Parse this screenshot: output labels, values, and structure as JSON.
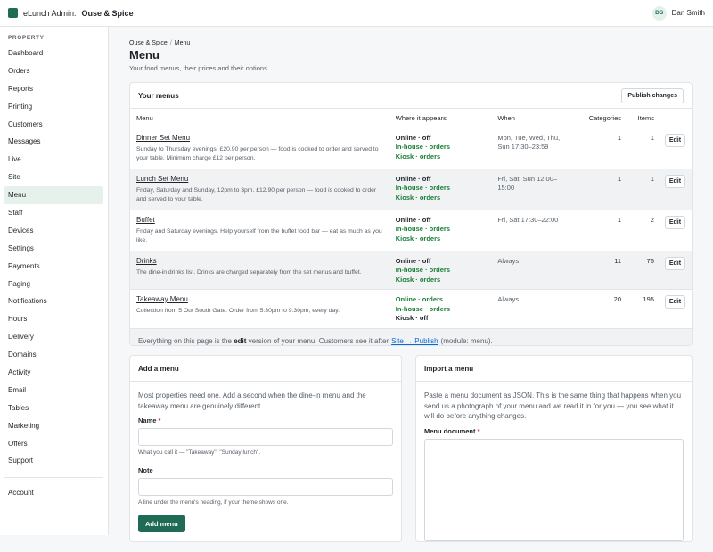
{
  "header": {
    "app_name": "eLunch Admin:",
    "venue_name": "Ouse & Spice",
    "user_initials": "DS",
    "user_name": "Dan Smith"
  },
  "sidebar": {
    "section": "PROPERTY",
    "items": [
      {
        "label": "Dashboard"
      },
      {
        "label": "Orders"
      },
      {
        "label": "Reports"
      },
      {
        "label": "Printing"
      },
      {
        "label": "Customers"
      },
      {
        "label": "Messages"
      },
      {
        "label": "Live"
      },
      {
        "label": "Site"
      },
      {
        "label": "Menu",
        "active": true
      },
      {
        "label": "Staff"
      },
      {
        "label": "Devices"
      },
      {
        "label": "Settings"
      },
      {
        "label": "Payments"
      },
      {
        "label": "Paging"
      },
      {
        "label": "Notifications"
      },
      {
        "label": "Hours"
      },
      {
        "label": "Delivery"
      },
      {
        "label": "Domains"
      },
      {
        "label": "Activity"
      },
      {
        "label": "Email"
      },
      {
        "label": "Tables"
      },
      {
        "label": "Marketing"
      },
      {
        "label": "Offers"
      },
      {
        "label": "Support"
      }
    ],
    "account": "Account"
  },
  "page": {
    "breadcrumb": [
      "Ouse & Spice",
      "Menu"
    ],
    "title": "Menu",
    "subtitle": "Your food menus, their prices and their options."
  },
  "menus_card": {
    "title": "Your menus",
    "publish_label": "Publish changes",
    "columns": [
      "Menu",
      "Where it appears",
      "When",
      "Categories",
      "Items"
    ],
    "edit_label": "Edit",
    "rows": [
      {
        "name": "Dinner Set Menu",
        "desc": "Sunday to Thursday evenings. £20.90 per person — food is cooked to order and served to your table. Minimum charge £12 per person.",
        "channels": [
          {
            "text": "Online · off",
            "on": false
          },
          {
            "text": "In-house · orders",
            "on": true
          },
          {
            "text": "Kiosk · orders",
            "on": true
          }
        ],
        "when": "Mon, Tue, Wed, Thu, Sun 17:30–23:59",
        "categories": "1",
        "items": "1"
      },
      {
        "name": "Lunch Set Menu",
        "desc": "Friday, Saturday and Sunday, 12pm to 3pm. £12.90 per person — food is cooked to order and served to your table.",
        "channels": [
          {
            "text": "Online · off",
            "on": false
          },
          {
            "text": "In-house · orders",
            "on": true
          },
          {
            "text": "Kiosk · orders",
            "on": true
          }
        ],
        "when": "Fri, Sat, Sun 12:00–15:00",
        "categories": "1",
        "items": "1"
      },
      {
        "name": "Buffet",
        "desc": "Friday and Saturday evenings. Help yourself from the buffet food bar — eat as much as you like.",
        "channels": [
          {
            "text": "Online · off",
            "on": false
          },
          {
            "text": "In-house · orders",
            "on": true
          },
          {
            "text": "Kiosk · orders",
            "on": true
          }
        ],
        "when": "Fri, Sat 17:30–22:00",
        "categories": "1",
        "items": "2"
      },
      {
        "name": "Drinks",
        "desc": "The dine-in drinks list. Drinks are charged separately from the set menus and buffet.",
        "channels": [
          {
            "text": "Online · off",
            "on": false
          },
          {
            "text": "In-house · orders",
            "on": true
          },
          {
            "text": "Kiosk · orders",
            "on": true
          }
        ],
        "when": "Always",
        "categories": "11",
        "items": "75"
      },
      {
        "name": "Takeaway Menu",
        "desc": "Collection from 5 Out South Gate. Order from 5:30pm to 9:30pm, every day.",
        "channels": [
          {
            "text": "Online · orders",
            "on": true
          },
          {
            "text": "In-house · orders",
            "on": true
          },
          {
            "text": "Kiosk · off",
            "on": false
          }
        ],
        "when": "Always",
        "categories": "20",
        "items": "195"
      }
    ],
    "footer": {
      "prefix": "Everything on this page is the",
      "strong": "edit",
      "middle": "version of your menu. Customers see it after",
      "link": "Site → Publish",
      "suffix": "(module: menu)."
    }
  },
  "add_menu": {
    "title": "Add a menu",
    "intro": "Most properties need one. Add a second when the dine-in menu and the takeaway menu are genuinely different.",
    "name_label": "Name",
    "required_mark": "*",
    "name_hint": "What you call it — \"Takeaway\", \"Sunday lunch\".",
    "note_label": "Note",
    "note_hint": "A line under the menu's heading, if your theme shows one.",
    "submit_label": "Add menu"
  },
  "import_menu": {
    "title": "Import a menu",
    "intro": "Paste a menu document as JSON. This is the same thing that happens when you send us a photograph of your menu and we read it in for you — you see what it will do before anything changes.",
    "doc_label": "Menu document",
    "required_mark": "*"
  },
  "colors": {
    "brand": "#1f6b55",
    "channel_on": "#1a7f37",
    "link": "#0969da",
    "required": "#cf222e"
  }
}
